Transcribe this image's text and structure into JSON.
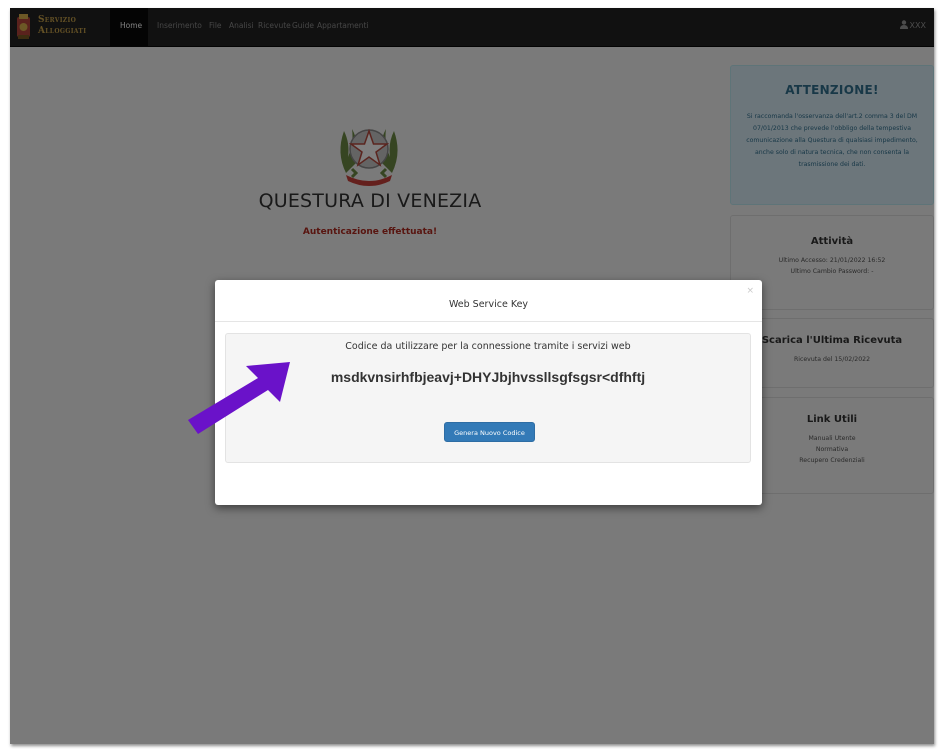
{
  "brand": {
    "line1": "Servizio",
    "line2": "Alloggiati"
  },
  "nav": {
    "items": [
      "Home",
      "Inserimento",
      "File",
      "Analisi",
      "Ricevute",
      "Guide",
      "Appartamenti"
    ],
    "active": "Home"
  },
  "user": {
    "icon": "user-icon",
    "name": "XXX"
  },
  "main": {
    "title": "QUESTURA DI VENEZIA",
    "auth_message": "Autenticazione effettuata!"
  },
  "warning_panel": {
    "title": "ATTENZIONE!",
    "text": "Si raccomanda l'osservanza dell'art.2 comma 3 del DM 07/01/2013 che prevede l'obbligo della tempestiva comunicazione alla Questura di qualsiasi impedimento, anche solo di natura tecnica, che non consenta la trasmissione dei dati."
  },
  "activity_panel": {
    "title": "Attività",
    "last_access": "Ultimo Accesso: 21/01/2022 16:52",
    "last_password_change": "Ultimo Cambio Password: -"
  },
  "receipt_panel": {
    "title": "Scarica l'Ultima Ricevuta",
    "text": "Ricevuta del 15/02/2022"
  },
  "links_panel": {
    "title": "Link Utili",
    "links": [
      "Manuali Utente",
      "Normativa",
      "Recupero Credenziali"
    ]
  },
  "modal": {
    "title": "Web Service Key",
    "close": "×",
    "description": "Codice da utilizzare per la connessione tramite i servizi web",
    "key": "msdkvnsirhfbjeavj+DHYJbjhvssllsgfsgsr<dfhftj",
    "button": "Genera Nuovo Codice"
  },
  "colors": {
    "navbar": "#222222",
    "brand_gold": "#c8a24a",
    "auth_red": "#b12a20",
    "primary_button": "#337ab7",
    "warning_bg": "#d9edf7",
    "warning_text": "#31708f",
    "annotation_arrow": "#6a12c9"
  }
}
